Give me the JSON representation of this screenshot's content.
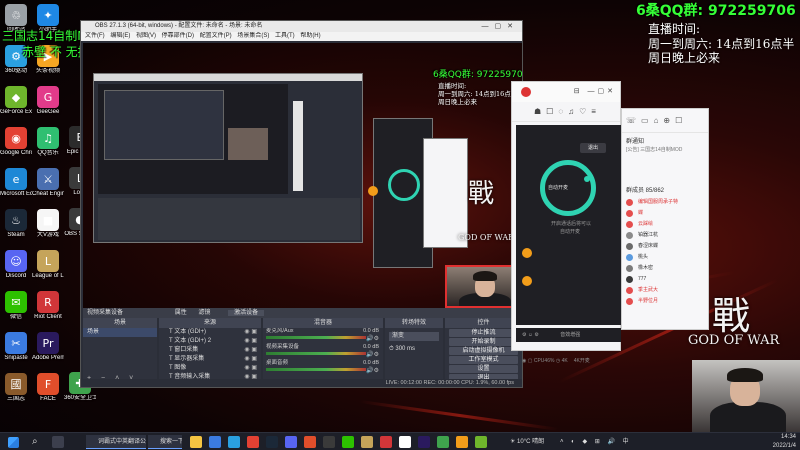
{
  "desktop_icons": [
    {
      "label": "回收站",
      "color": "#9aa0a6",
      "glyph": "♲"
    },
    {
      "label": "360驱动",
      "color": "#2aa0e0",
      "glyph": "⚙"
    },
    {
      "label": "GeForce Experience",
      "color": "#6fb52c",
      "glyph": "◆"
    },
    {
      "label": "Google Chrome",
      "color": "#e34133",
      "glyph": "◉"
    },
    {
      "label": "Microsoft Edge",
      "color": "#1e88d6",
      "glyph": "e"
    },
    {
      "label": "Steam",
      "color": "#1b2838",
      "glyph": "♨"
    },
    {
      "label": "Discord",
      "color": "#5865f2",
      "glyph": "☺"
    },
    {
      "label": "微信",
      "color": "#2dc100",
      "glyph": "✉"
    },
    {
      "label": "Snipaste",
      "color": "#3b7be0",
      "glyph": "✂"
    },
    {
      "label": "三国志",
      "color": "#8a5a2b",
      "glyph": "國"
    },
    {
      "label": "小助手",
      "color": "#1e88e5",
      "glyph": "✦"
    },
    {
      "label": "头条视频",
      "color": "#f5a623",
      "glyph": "▶"
    },
    {
      "label": "GeeGee",
      "color": "#e23b8a",
      "glyph": "G"
    },
    {
      "label": "QQ音乐",
      "color": "#2fbf71",
      "glyph": "♫"
    },
    {
      "label": "Cheat Engine",
      "color": "#4a6fb0",
      "glyph": "⚔"
    },
    {
      "label": "大V游戏",
      "color": "#f6f6f6",
      "glyph": "■"
    },
    {
      "label": "League of Legends",
      "color": "#c5a45a",
      "glyph": "L"
    },
    {
      "label": "Riot Client",
      "color": "#d13639",
      "glyph": "R"
    },
    {
      "label": "Adobe Premie...",
      "color": "#2a1a5e",
      "glyph": "Pr"
    },
    {
      "label": "FACE",
      "color": "#e04e2b",
      "glyph": "F"
    },
    {
      "label": "Epic Ga...",
      "color": "#2b2b2b",
      "glyph": "E"
    },
    {
      "label": "Loop",
      "color": "#3a3a3a",
      "glyph": "L"
    },
    {
      "label": "OBS Studio",
      "color": "#3a3a3a",
      "glyph": "●"
    },
    {
      "label": "360安全卫士",
      "color": "#3fa34d",
      "glyph": "✚"
    }
  ],
  "overlay": {
    "qq_group_big": "6桑QQ群:  972259706",
    "schedule_title": "直播时间:",
    "schedule_line1": "周一到周六: 14点到16点半",
    "schedule_line2": "周日晚上必来",
    "green_line1": "三国志14自制MOD重战双窝茨茨一剑剑10",
    "green_line2": "赤壁  不  无挑衅  无外交  斯魏小  无伤兵"
  },
  "obs": {
    "title": "OBS 27.1.3 (64-bit, windows) - 配置文件: 未命名 - 场景: 未命名",
    "menu": "文件(F)  编辑(E)  视图(V)  停靠部件(D)  配置文件(P)  场景集合(S)  工具(T)  帮助(H)",
    "source_bar": "视频采集设备",
    "source_bar_btn1": "属性",
    "source_bar_btn2": "滤镜",
    "source_bar_btn3": "激活设备",
    "docks": {
      "scenes": "场景",
      "sources": "来源",
      "mixer": "混音器",
      "transitions": "转场特效",
      "controls": "控件"
    },
    "scene_item": "场景",
    "sources": [
      "文本 (GDI+)",
      "文本 (GDI+) 2",
      "窗口采集",
      "显示器采集",
      "图像",
      "音频输入采集"
    ],
    "mixer": [
      {
        "name": "麦克风/Aux",
        "db": "0.0 dB"
      },
      {
        "name": "视频采集设备",
        "db": "0.0 dB"
      },
      {
        "name": "桌面音频",
        "db": "0.0 dB"
      }
    ],
    "transition_name": "渐变",
    "transition_duration": "300 ms",
    "controls": [
      "停止推流",
      "开始录制",
      "启动虚拟摄像机",
      "工作室模式",
      "设置",
      "退出"
    ],
    "status": "LIVE: 00:12:00   REC: 00:00:00   CPU: 1.9%, 60.00 fps"
  },
  "preview_overlay": {
    "qq_small": "6桑QQ群:  972259706",
    "schedule_title": "直播时间:",
    "schedule_line1": "周一到周六: 14点到16点半",
    "schedule_line2": "周日晚上必来"
  },
  "qq": {
    "exit_label": "退出",
    "call_label": "自动开麦",
    "caption1": "开启通话后将可以",
    "caption2": "自动开麦",
    "group_notice": "群通知",
    "notice_text": "[公告] 三国志14自制MOD",
    "members_title": "群成员 85/862",
    "members": [
      {
        "name": "编辑国服周承子特",
        "color": "#e44d4d"
      },
      {
        "name": "蝶",
        "color": "#e44d4d"
      },
      {
        "name": "云踩绘",
        "color": "#e44d4d"
      },
      {
        "name": "铂器江杭",
        "color": "#8a8a8a"
      },
      {
        "name": "春涩床蝶",
        "color": "#6a6a6a"
      },
      {
        "name": "桃头",
        "color": "#5a9ade"
      },
      {
        "name": "橡木密",
        "color": "#7a7a7a"
      },
      {
        "name": "777",
        "color": "#3a3a3a"
      },
      {
        "name": "季主武大",
        "color": "#e44d4d"
      },
      {
        "name": "半野位月",
        "color": "#e44d4d"
      }
    ],
    "bottom_btn": "音效增强",
    "bottom_right": "4K开麦"
  },
  "god_of_war": {
    "big": "戰",
    "text": "GOD OF WAR"
  },
  "taskbar": {
    "task1": "词霸式中英翻译公司",
    "task2": "搜索一下",
    "temp": "10°C 晴朗",
    "time": "14:34",
    "date": "2022/1/4"
  }
}
